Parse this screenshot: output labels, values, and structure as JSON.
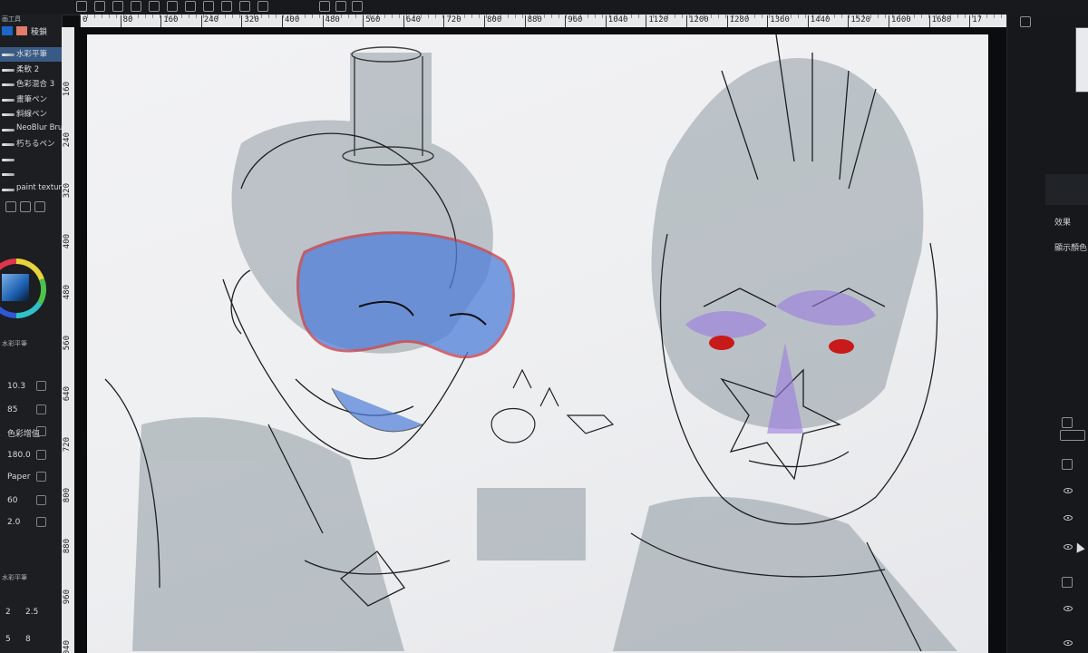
{
  "toolbar": {
    "icons": [
      "menu-icon",
      "new-file-icon",
      "open-folder-icon",
      "save-icon",
      "layer-icon",
      "undo-icon",
      "redo-icon",
      "select-icon",
      "lasso-icon",
      "transform-icon",
      "fill-icon",
      "pen-icon",
      "eraser-icon",
      "shape-icon"
    ]
  },
  "ruler": {
    "top_labels": [
      "0",
      "80",
      "160",
      "240",
      "320",
      "400",
      "480",
      "560",
      "640",
      "720",
      "800",
      "880",
      "960",
      "1040",
      "1120",
      "1200",
      "1280",
      "1360",
      "1440",
      "1520",
      "1600",
      "1680",
      "17"
    ],
    "left_labels": [
      "160",
      "240",
      "320",
      "400",
      "480",
      "560",
      "640",
      "720",
      "800",
      "880",
      "960",
      "1040"
    ]
  },
  "left_panel": {
    "header": "画工具",
    "brush_group": "稜鎖",
    "brushes": [
      {
        "label": "水彩平筆",
        "selected": true
      },
      {
        "label": "柔軟 2",
        "selected": false
      },
      {
        "label": "色彩混合 3",
        "selected": false
      },
      {
        "label": "畫筆ペン",
        "selected": false
      },
      {
        "label": "斜線ペン",
        "selected": false
      },
      {
        "label": "NeoBlur Brush",
        "selected": false
      },
      {
        "label": "朽ちるペン",
        "selected": false
      },
      {
        "label": "",
        "selected": false
      },
      {
        "label": "",
        "selected": false
      },
      {
        "label": "paint texture brush",
        "selected": false
      }
    ],
    "sub_tool_name": "水彩平筆",
    "params": [
      {
        "value": "10.3"
      },
      {
        "value": "85"
      },
      {
        "value": "色彩增值"
      },
      {
        "value": "180.0"
      },
      {
        "value": "Paper"
      },
      {
        "value": "60"
      },
      {
        "value": "2.0"
      }
    ],
    "bottom_label": "水彩平筆",
    "size_presets": [
      "2",
      "2.5",
      "5",
      "8"
    ]
  },
  "right_panel": {
    "effect_label": "效果",
    "display_color_label": "顯示顏色"
  },
  "colors": {
    "accent_selected": "#3a5a86",
    "mask_blue": "#4f7fd9",
    "mask_red": "#c43a4a",
    "eye_red": "#c81a1a",
    "eye_purple": "#9b7be0",
    "wash_gray": "#7d8a92"
  }
}
